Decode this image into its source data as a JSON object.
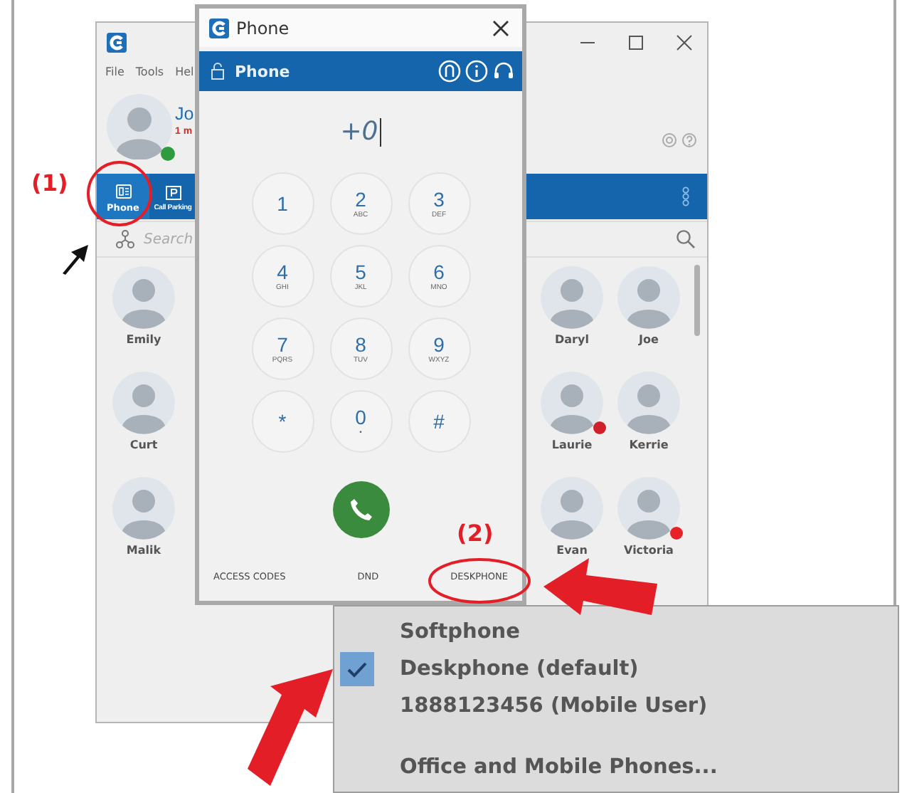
{
  "main_window": {
    "menu": [
      "File",
      "Tools",
      "Hel"
    ],
    "user": {
      "name": "Jo",
      "status_text": "1 m",
      "color": "#2e9b3e"
    },
    "toolbar": [
      {
        "label": "Phone",
        "kind": "phone",
        "selected": true
      },
      {
        "label": "Call Parking",
        "kind": "parking",
        "selected": false
      }
    ],
    "search": {
      "placeholder": "Search"
    },
    "contacts": [
      {
        "name": "Emily"
      },
      {
        "name": "Daryl"
      },
      {
        "name": "Joe"
      },
      {
        "name": "Curt"
      },
      {
        "name": "Laurie",
        "color": "#d0202a"
      },
      {
        "name": "Kerrie"
      },
      {
        "name": "Malik"
      },
      {
        "name": "Evan"
      },
      {
        "name": "Victoria",
        "color": "#e8202a"
      }
    ]
  },
  "phone_dialog": {
    "title": "Phone",
    "header": "Phone",
    "number": "+0",
    "keys": [
      {
        "digit": "1"
      },
      {
        "digit": "2",
        "letters": "ABC"
      },
      {
        "digit": "3",
        "letters": "DEF"
      },
      {
        "digit": "4",
        "letters": "GHI"
      },
      {
        "digit": "5",
        "letters": "JKL"
      },
      {
        "digit": "6",
        "letters": "MNO"
      },
      {
        "digit": "7",
        "letters": "PQRS"
      },
      {
        "digit": "8",
        "letters": "TUV"
      },
      {
        "digit": "9",
        "letters": "WXYZ"
      },
      {
        "digit": "*"
      },
      {
        "digit": "0",
        "letters": "•"
      },
      {
        "digit": "#"
      }
    ],
    "footer": [
      "ACCESS CODES",
      "DND",
      "DESKPHONE"
    ]
  },
  "menu": {
    "items": [
      {
        "label": "Softphone",
        "checked": false
      },
      {
        "label": "Deskphone (default)",
        "checked": true
      },
      {
        "label": "1888123456 (Mobile User)",
        "checked": false
      }
    ],
    "footer_item": "Office and Mobile Phones..."
  },
  "annotations": [
    {
      "label": "(1)"
    },
    {
      "label": "(2)"
    }
  ]
}
